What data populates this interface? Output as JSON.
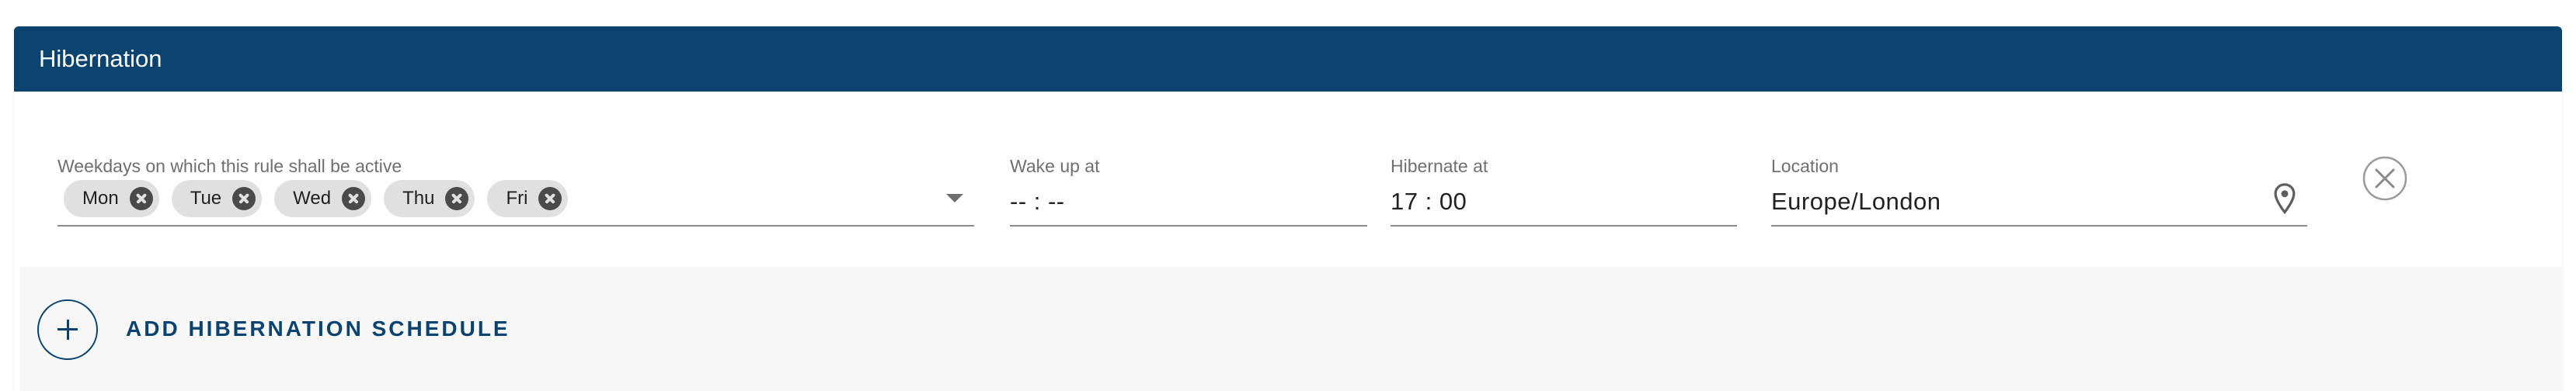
{
  "header": {
    "title": "Hibernation"
  },
  "rule": {
    "weekdays": {
      "label": "Weekdays on which this rule shall be active",
      "selected": [
        "Mon",
        "Tue",
        "Wed",
        "Thu",
        "Fri"
      ]
    },
    "wake_up": {
      "label": "Wake up at",
      "value": "-- : --"
    },
    "hibernate": {
      "label": "Hibernate at",
      "value": "17 : 00"
    },
    "location": {
      "label": "Location",
      "value": "Europe/London"
    }
  },
  "actions": {
    "add_schedule_label": "ADD HIBERNATION SCHEDULE"
  },
  "icons": {
    "chip_remove": "close-circle-icon",
    "weekdays_dropdown": "chevron-down-icon",
    "location": "map-pin-icon",
    "remove_rule": "close-circle-outline-icon",
    "add": "plus-circle-outline-icon"
  },
  "colors": {
    "header_bg": "#0b4370",
    "accent": "#0b4370",
    "chip_bg": "#e0e0e0",
    "add_bar_bg": "#f7f7f7"
  }
}
